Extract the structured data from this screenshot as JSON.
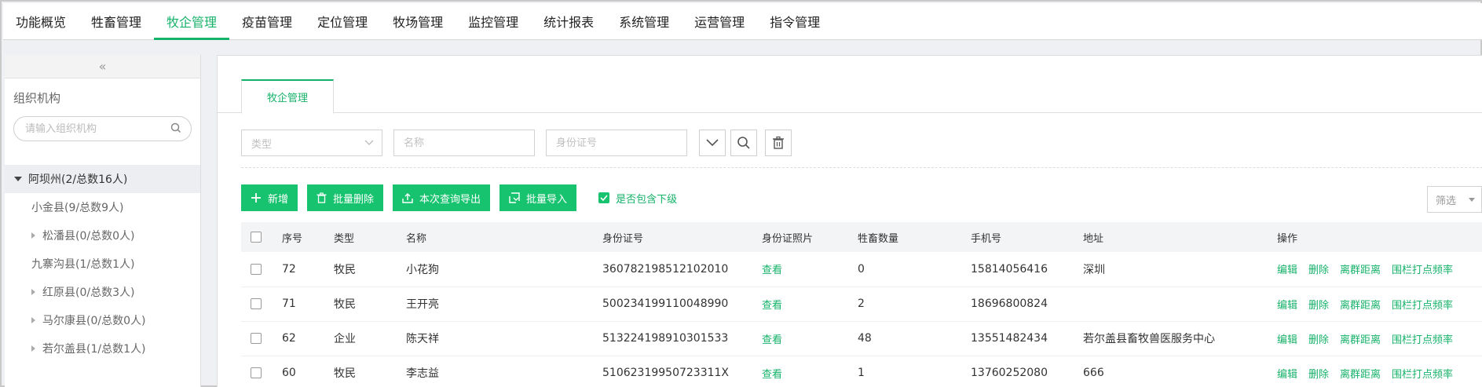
{
  "nav": {
    "items": [
      "功能概览",
      "牲畜管理",
      "牧企管理",
      "疫苗管理",
      "定位管理",
      "牧场管理",
      "监控管理",
      "统计报表",
      "系统管理",
      "运营管理",
      "指令管理"
    ],
    "active_index": 2
  },
  "sidebar": {
    "collapse_glyph": "«",
    "title": "组织机构",
    "search_placeholder": "请输入组织机构",
    "root": "阿坝州(2/总数16人)",
    "nodes": [
      {
        "label": "小金县(9/总数9人)",
        "expandable": false
      },
      {
        "label": "松潘县(0/总数0人)",
        "expandable": true
      },
      {
        "label": "九寨沟县(1/总数1人)",
        "expandable": false
      },
      {
        "label": "红原县(0/总数3人)",
        "expandable": true
      },
      {
        "label": "马尔康县(0/总数0人)",
        "expandable": true
      },
      {
        "label": "若尔盖县(1/总数1人)",
        "expandable": true
      }
    ]
  },
  "main": {
    "tab": "牧企管理",
    "filters": {
      "type_placeholder": "类型",
      "name_placeholder": "名称",
      "id_placeholder": "身份证号"
    },
    "buttons": {
      "add": "新增",
      "batch_delete": "批量删除",
      "export": "本次查询导出",
      "import": "批量导入"
    },
    "include_sub": "是否包含下级",
    "filter_select": "筛选",
    "table": {
      "headers": [
        "序号",
        "类型",
        "名称",
        "身份证号",
        "身份证照片",
        "牲畜数量",
        "手机号",
        "地址",
        "操作"
      ],
      "view_label": "查看",
      "ops": [
        "编辑",
        "删除",
        "离群距离",
        "围栏打点频率"
      ],
      "rows": [
        {
          "no": "72",
          "type": "牧民",
          "name": "小花狗",
          "id": "360782198512102010",
          "count": "0",
          "phone": "15814056416",
          "addr": "深圳"
        },
        {
          "no": "71",
          "type": "牧民",
          "name": "王开亮",
          "id": "500234199110048990",
          "count": "2",
          "phone": "18696800824",
          "addr": ""
        },
        {
          "no": "62",
          "type": "企业",
          "name": "陈天祥",
          "id": "513224198910301533",
          "count": "48",
          "phone": "13551482434",
          "addr": "若尔盖县畜牧兽医服务中心"
        },
        {
          "no": "60",
          "type": "牧民",
          "name": "李志益",
          "id": "51062319950723311X",
          "count": "1",
          "phone": "13760252080",
          "addr": "666"
        }
      ]
    }
  },
  "colors": {
    "accent": "#17b26a",
    "button": "#17c36e"
  }
}
